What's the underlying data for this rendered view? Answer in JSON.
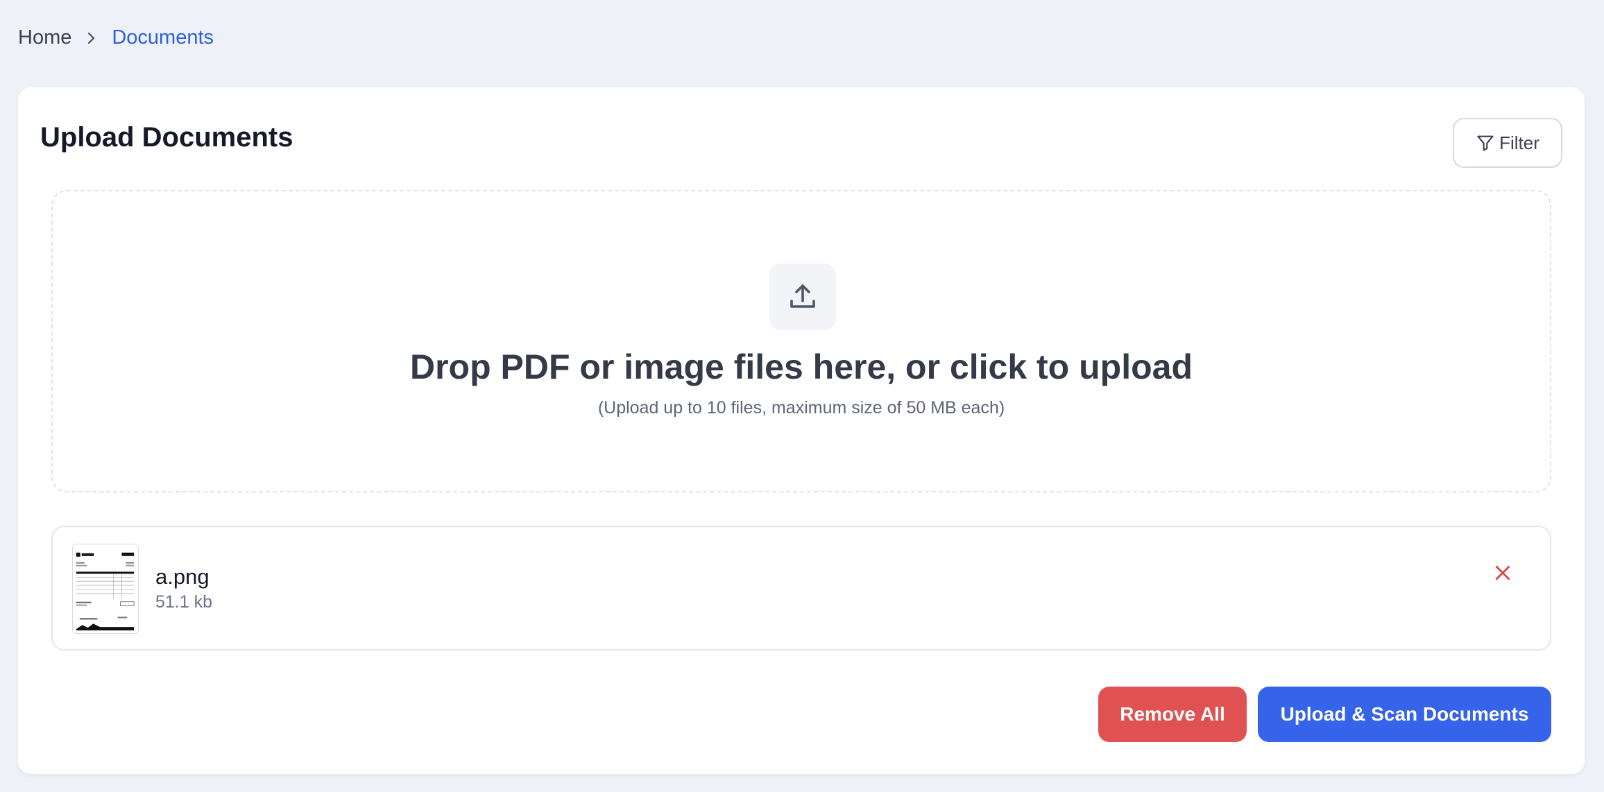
{
  "breadcrumb": {
    "home": "Home",
    "current": "Documents"
  },
  "card": {
    "title": "Upload Documents",
    "filter_label": "Filter"
  },
  "dropzone": {
    "icon": "upload-icon",
    "title": "Drop PDF or image files here, or click to upload",
    "subtitle": "(Upload up to 10 files, maximum size of 50 MB each)"
  },
  "files": [
    {
      "name": "a.png",
      "size": "51.1 kb",
      "thumbnail_icon": "invoice-thumbnail"
    }
  ],
  "actions": {
    "remove_all": "Remove All",
    "upload_scan": "Upload & Scan Documents"
  },
  "colors": {
    "accent": "#3563e9",
    "danger": "#e05252",
    "breadcrumb_active": "#2f5fd8",
    "background": "#eef1f8"
  }
}
